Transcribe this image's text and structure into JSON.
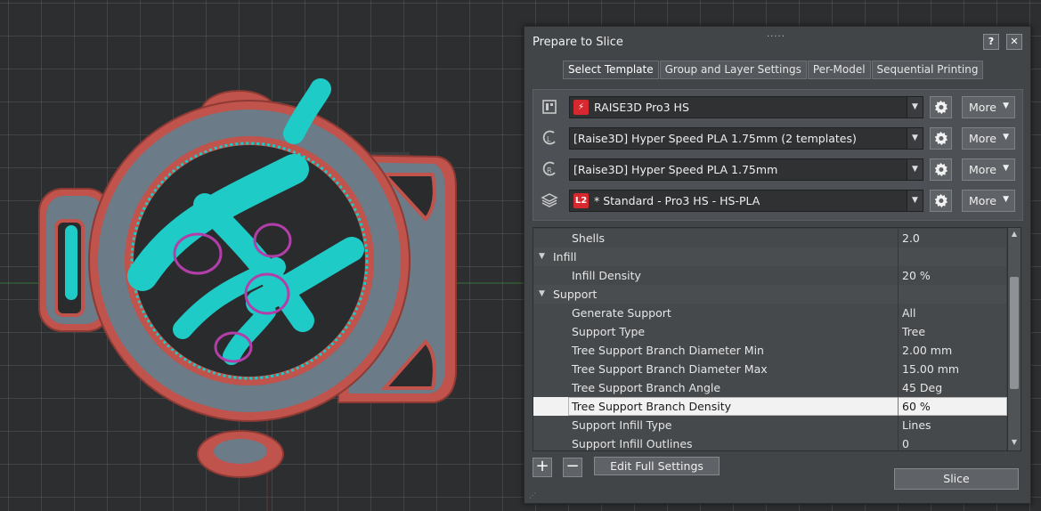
{
  "dialog": {
    "title": "Prepare to Slice",
    "help_label": "?",
    "close_label": "✕",
    "drag_handle": "....."
  },
  "tabs": [
    {
      "label": "Select Template",
      "active": true
    },
    {
      "label": "Group and Layer Settings",
      "active": false
    },
    {
      "label": "Per-Model",
      "active": false
    },
    {
      "label": "Sequential Printing",
      "active": false
    }
  ],
  "profiles": {
    "printer": {
      "badge": "⚡",
      "value": "RAISE3D Pro3 HS",
      "more": "More",
      "icon": "printer-icon"
    },
    "material_left": {
      "value": "[Raise3D] Hyper Speed PLA 1.75mm (2 templates)",
      "more": "More",
      "icon": "left-extruder-icon"
    },
    "material_right": {
      "value": "[Raise3D] Hyper Speed PLA 1.75mm",
      "more": "More",
      "icon": "right-extruder-icon"
    },
    "template": {
      "badge": "L2",
      "value": "* Standard - Pro3 HS - HS-PLA",
      "more": "More",
      "icon": "layers-icon"
    }
  },
  "settings": [
    {
      "label": "Shells",
      "value": "2.0",
      "kind": "item"
    },
    {
      "label": "Infill",
      "value": "",
      "kind": "category"
    },
    {
      "label": "Infill Density",
      "value": "20 %",
      "kind": "item"
    },
    {
      "label": "Support",
      "value": "",
      "kind": "category"
    },
    {
      "label": "Generate Support",
      "value": "All",
      "kind": "item"
    },
    {
      "label": "Support Type",
      "value": "Tree",
      "kind": "item"
    },
    {
      "label": "Tree Support Branch Diameter Min",
      "value": "2.00 mm",
      "kind": "item"
    },
    {
      "label": "Tree Support Branch Diameter Max",
      "value": "15.00 mm",
      "kind": "item"
    },
    {
      "label": "Tree Support Branch Angle",
      "value": "45 Deg",
      "kind": "item"
    },
    {
      "label": "Tree Support Branch Density",
      "value": "60 %",
      "kind": "item",
      "selected": true
    },
    {
      "label": "Support Infill Type",
      "value": "Lines",
      "kind": "item"
    },
    {
      "label": "Support Infill Outlines",
      "value": "0",
      "kind": "item"
    }
  ],
  "footer": {
    "add_label": "+",
    "remove_label": "−",
    "edit_full_settings": "Edit Full Settings",
    "slice": "Slice"
  },
  "colors": {
    "accent_badge": "#d7282f",
    "model_shell": "#c0534c",
    "model_top": "#6b7b88",
    "support": "#1ecbc6",
    "interface": "#b23fa9"
  }
}
